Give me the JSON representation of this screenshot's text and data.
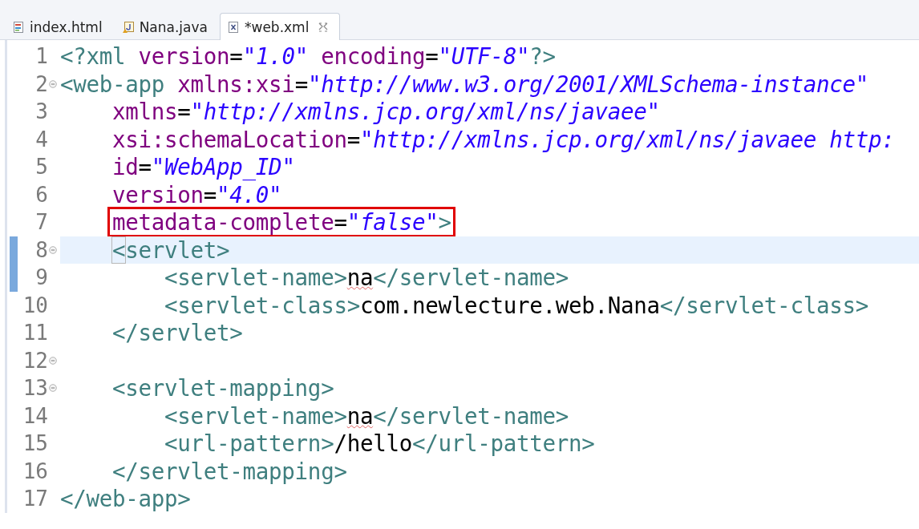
{
  "tabs": [
    {
      "label": "index.html",
      "kind": "html",
      "selected": false
    },
    {
      "label": "Nana.java",
      "kind": "java",
      "selected": false
    },
    {
      "label": "*web.xml",
      "kind": "xml",
      "selected": true
    }
  ],
  "editor": {
    "lines": [
      {
        "number": "1",
        "foldable": false,
        "current": false,
        "changed": false,
        "boxed": false,
        "tokens": [
          {
            "kind": "tag",
            "text": "<?xml"
          },
          {
            "kind": "attr",
            "text": " version"
          },
          {
            "kind": "eq",
            "text": "="
          },
          {
            "kind": "str",
            "text": "\"1.0\""
          },
          {
            "kind": "attr",
            "text": " encoding"
          },
          {
            "kind": "eq",
            "text": "="
          },
          {
            "kind": "str",
            "text": "\"UTF-8\""
          },
          {
            "kind": "tag",
            "text": "?>"
          }
        ]
      },
      {
        "number": "2",
        "foldable": true,
        "current": false,
        "changed": false,
        "boxed": false,
        "tokens": [
          {
            "kind": "tag",
            "text": "<web-app"
          },
          {
            "kind": "attr",
            "text": " xmlns:xsi"
          },
          {
            "kind": "eq",
            "text": "="
          },
          {
            "kind": "str",
            "text": "\"http://www.w3.org/2001/XMLSchema-instance\""
          }
        ]
      },
      {
        "number": "3",
        "foldable": false,
        "current": false,
        "changed": false,
        "boxed": false,
        "tokens": [
          {
            "kind": "attr",
            "text": "    xmlns"
          },
          {
            "kind": "eq",
            "text": "="
          },
          {
            "kind": "str",
            "text": "\"http://xmlns.jcp.org/xml/ns/javaee\""
          }
        ]
      },
      {
        "number": "4",
        "foldable": false,
        "current": false,
        "changed": false,
        "boxed": false,
        "tokens": [
          {
            "kind": "attr",
            "text": "    xsi:schemaLocation"
          },
          {
            "kind": "eq",
            "text": "="
          },
          {
            "kind": "str",
            "text": "\"http://xmlns.jcp.org/xml/ns/javaee http:"
          }
        ]
      },
      {
        "number": "5",
        "foldable": false,
        "current": false,
        "changed": false,
        "boxed": false,
        "tokens": [
          {
            "kind": "attr",
            "text": "    id"
          },
          {
            "kind": "eq",
            "text": "="
          },
          {
            "kind": "str",
            "text": "\"WebApp_ID\""
          }
        ]
      },
      {
        "number": "6",
        "foldable": false,
        "current": false,
        "changed": false,
        "boxed": false,
        "tokens": [
          {
            "kind": "attr",
            "text": "    version"
          },
          {
            "kind": "eq",
            "text": "="
          },
          {
            "kind": "str",
            "text": "\"4.0\""
          }
        ]
      },
      {
        "number": "7",
        "foldable": false,
        "current": false,
        "changed": false,
        "boxed": true,
        "tokens": [
          {
            "kind": "attr",
            "text": "    metadata-complete"
          },
          {
            "kind": "eq",
            "text": "="
          },
          {
            "kind": "str",
            "text": "\"false\""
          },
          {
            "kind": "tag",
            "text": ">"
          }
        ]
      },
      {
        "number": "8",
        "foldable": true,
        "current": true,
        "changed": true,
        "boxed": false,
        "tokens": [
          {
            "kind": "tag",
            "text": "    <",
            "matched": true
          },
          {
            "kind": "tag",
            "text": "servlet>"
          }
        ]
      },
      {
        "number": "9",
        "foldable": false,
        "current": false,
        "changed": true,
        "boxed": false,
        "tokens": [
          {
            "kind": "tag",
            "text": "        <servlet-name>"
          },
          {
            "kind": "text",
            "text": "na",
            "misspelled": true
          },
          {
            "kind": "tag",
            "text": "</servlet-name>"
          }
        ]
      },
      {
        "number": "10",
        "foldable": false,
        "current": false,
        "changed": false,
        "boxed": false,
        "tokens": [
          {
            "kind": "tag",
            "text": "        <servlet-class>"
          },
          {
            "kind": "text",
            "text": "com.newlecture.web.Nana"
          },
          {
            "kind": "tag",
            "text": "</servlet-class>"
          }
        ]
      },
      {
        "number": "11",
        "foldable": false,
        "current": false,
        "changed": false,
        "boxed": false,
        "tokens": [
          {
            "kind": "tag",
            "text": "    </servlet>"
          }
        ]
      },
      {
        "number": "12",
        "foldable": true,
        "current": false,
        "changed": false,
        "boxed": false
      },
      {
        "number": "13",
        "foldable": true,
        "current": false,
        "changed": false,
        "boxed": false,
        "tokens": [
          {
            "kind": "tag",
            "text": "    <servlet-mapping>"
          }
        ]
      },
      {
        "number": "14",
        "foldable": false,
        "current": false,
        "changed": false,
        "boxed": false,
        "tokens": [
          {
            "kind": "tag",
            "text": "        <servlet-name>"
          },
          {
            "kind": "text",
            "text": "na",
            "misspelled": true
          },
          {
            "kind": "tag",
            "text": "</servlet-name>"
          }
        ]
      },
      {
        "number": "15",
        "foldable": false,
        "current": false,
        "changed": false,
        "boxed": false,
        "tokens": [
          {
            "kind": "tag",
            "text": "        <url-pattern>"
          },
          {
            "kind": "text",
            "text": "/hello"
          },
          {
            "kind": "tag",
            "text": "</url-pattern>"
          }
        ]
      },
      {
        "number": "16",
        "foldable": false,
        "current": false,
        "changed": false,
        "boxed": false,
        "tokens": [
          {
            "kind": "tag",
            "text": "    </servlet-mapping>"
          }
        ]
      },
      {
        "number": "17",
        "foldable": false,
        "current": false,
        "changed": false,
        "boxed": false,
        "tokens": [
          {
            "kind": "tag",
            "text": "</web-app>"
          }
        ]
      }
    ]
  }
}
